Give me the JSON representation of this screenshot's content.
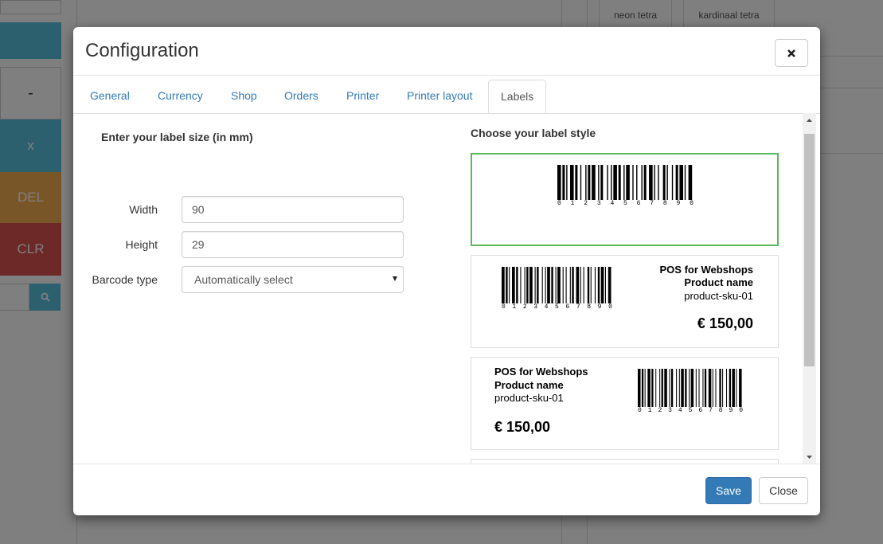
{
  "background": {
    "keypad": {
      "minus": "-",
      "x": "x",
      "del": "DEL",
      "clr": "CLR"
    },
    "products": [
      "neon tetra",
      "kardinaal tetra"
    ]
  },
  "modal": {
    "title": "Configuration",
    "tabs": [
      {
        "label": "General"
      },
      {
        "label": "Currency"
      },
      {
        "label": "Shop"
      },
      {
        "label": "Orders"
      },
      {
        "label": "Printer"
      },
      {
        "label": "Printer layout"
      },
      {
        "label": "Labels",
        "active": true
      }
    ],
    "label_size": {
      "title": "Enter your label size (in mm)",
      "width_label": "Width",
      "width_value": "90",
      "height_label": "Height",
      "height_value": "29",
      "barcode_type_label": "Barcode type",
      "barcode_type_value": "Automatically select"
    },
    "label_style": {
      "title": "Choose your label style",
      "barcode_digits": [
        "0",
        "1",
        "2",
        "3",
        "4",
        "5",
        "6",
        "7",
        "8",
        "9",
        "0"
      ],
      "shop_name": "POS for Webshops",
      "product_name": "Product name",
      "sku": "product-sku-01",
      "price": "€ 150,00"
    },
    "footer": {
      "save_label": "Save",
      "close_label": "Close"
    }
  },
  "colors": {
    "primary": "#337ab7",
    "selected_border": "#5cb85c",
    "info": "#5bc0de",
    "warning": "#f0ad4e",
    "danger": "#d9534f"
  }
}
